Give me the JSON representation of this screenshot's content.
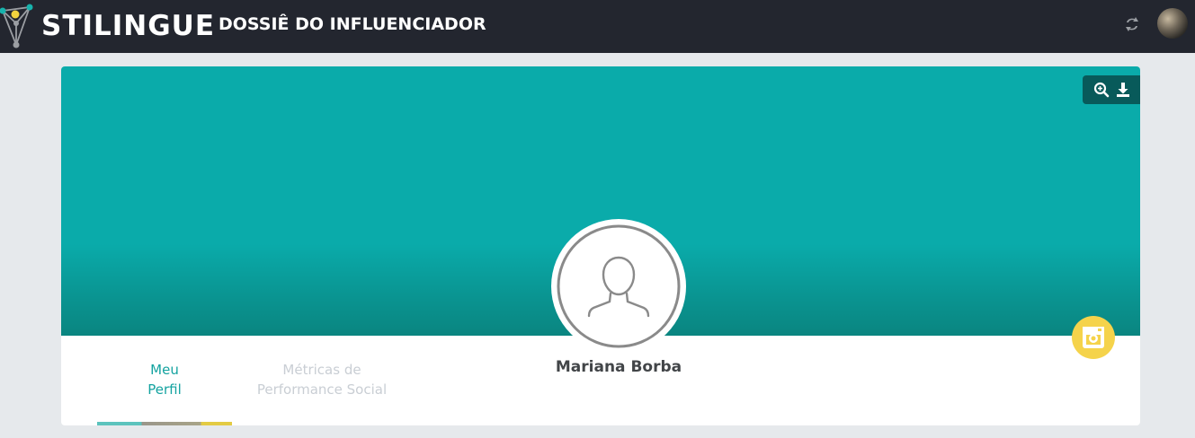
{
  "header": {
    "brand": "STILINGUE",
    "title": "DOSSIÊ DO INFLUENCIADOR",
    "icons": [
      "stilingue-logo-icon",
      "refresh-icon",
      "user-avatar"
    ]
  },
  "profile": {
    "name": "Mariana Borba",
    "network": "instagram",
    "cover_actions": [
      "zoom-icon",
      "download-icon"
    ]
  },
  "tabs": [
    {
      "label_line1": "Meu",
      "label_line2": "Perfil",
      "active": true
    },
    {
      "label_line1": "Métricas de",
      "label_line2": "Performance Social",
      "active": false
    }
  ],
  "colors": {
    "topbar": "#23262f",
    "cover": "#0aabaa",
    "accent": "#14a3a0",
    "instagram_badge": "#f5d34b"
  }
}
